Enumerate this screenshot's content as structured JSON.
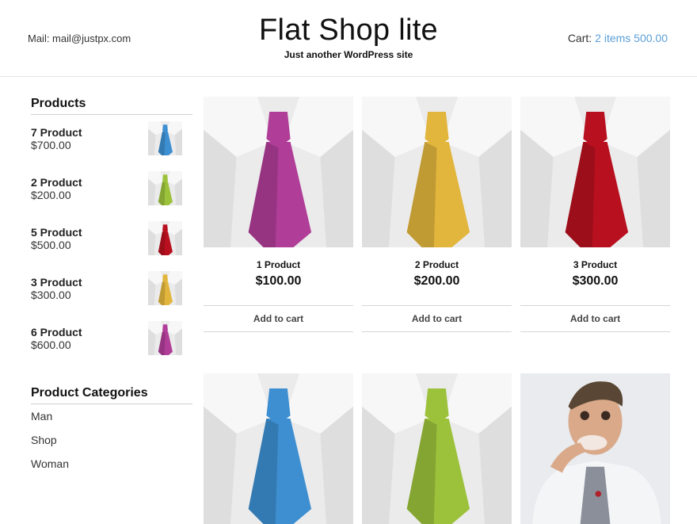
{
  "header": {
    "mail": "Mail: mail@justpx.com",
    "site_title": "Flat Shop lite",
    "tagline": "Just another WordPress site",
    "cart_label": "Cart:",
    "cart_summary": "2 items 500.00"
  },
  "sidebar": {
    "products_title": "Products",
    "products": [
      {
        "name": "7 Product",
        "price": "$700.00",
        "tie_color": "#3d8fd1"
      },
      {
        "name": "2 Product",
        "price": "$200.00",
        "tie_color": "#9cc23b"
      },
      {
        "name": "5 Product",
        "price": "$500.00",
        "tie_color": "#b8101f"
      },
      {
        "name": "3 Product",
        "price": "$300.00",
        "tie_color": "#e2b53c"
      },
      {
        "name": "6 Product",
        "price": "$600.00",
        "tie_color": "#b03d98"
      }
    ],
    "categories_title": "Product Categories",
    "categories": [
      "Man",
      "Shop",
      "Woman"
    ]
  },
  "grid": {
    "products": [
      {
        "name": "1 Product",
        "price": "$100.00",
        "button": "Add to cart",
        "tie_color": "#b03d98"
      },
      {
        "name": "2 Product",
        "price": "$200.00",
        "button": "Add to cart",
        "tie_color": "#e2b53c"
      },
      {
        "name": "3 Product",
        "price": "$300.00",
        "button": "Add to cart",
        "tie_color": "#b8101f"
      }
    ],
    "row2": [
      {
        "tie_color": "#3d8fd1"
      },
      {
        "tie_color": "#9cc23b"
      },
      {
        "tie_color": "#8a8f99"
      }
    ]
  }
}
